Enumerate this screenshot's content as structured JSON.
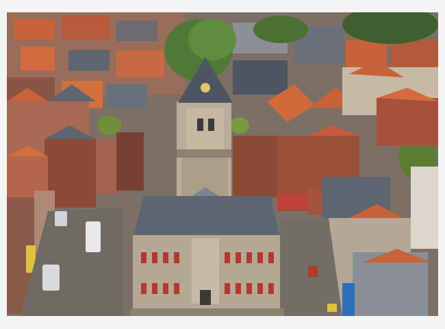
{
  "image": {
    "subject": "aerial-view-old-town-square",
    "palette": {
      "roof_terracotta": "#c8623a",
      "roof_slate": "#5d6570",
      "stone": "#b9ad99",
      "brick": "#8c4a35",
      "plaza": "#6f6a62",
      "tree_green": "#4f7a35",
      "shutter_red": "#b3392f",
      "awning_blue": "#2f6fb8",
      "awning_yellow": "#e1c23c"
    }
  }
}
